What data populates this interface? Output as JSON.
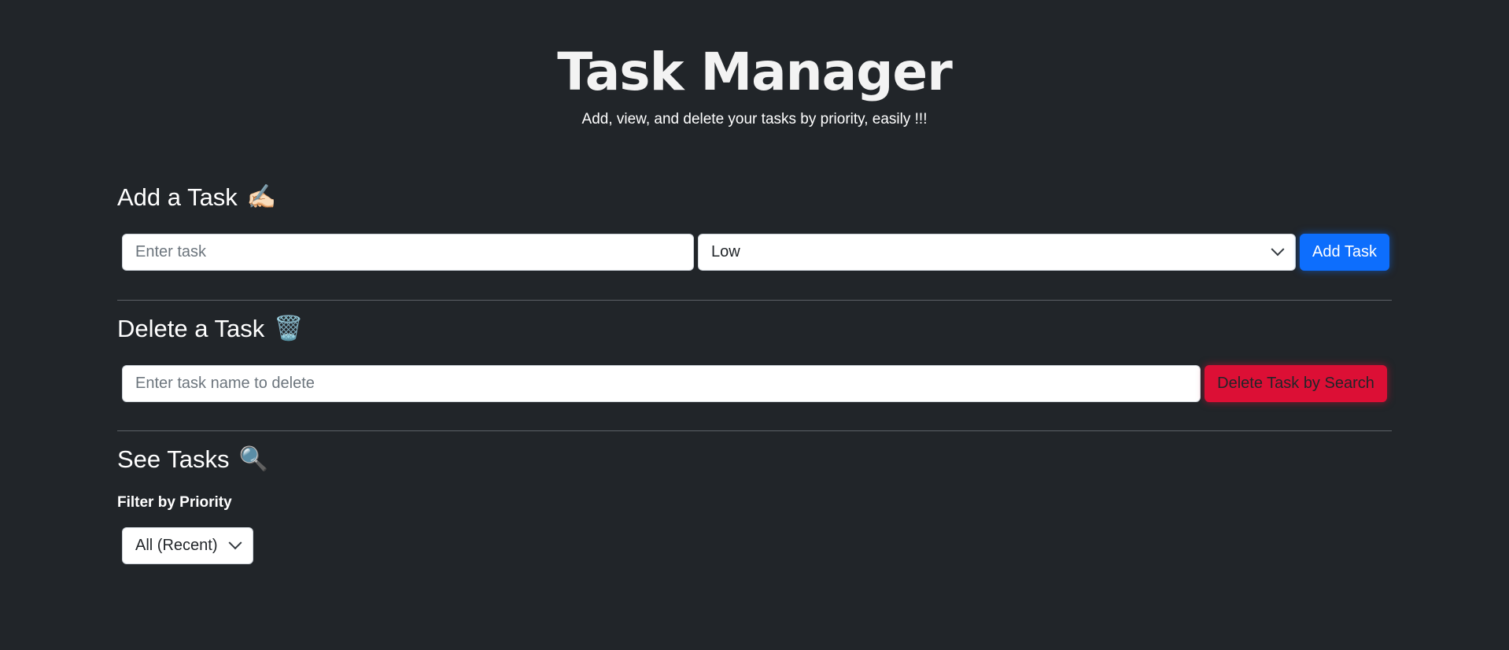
{
  "header": {
    "title": "Task Manager",
    "subtitle": "Add, view, and delete your tasks by priority, easily !!!"
  },
  "add_section": {
    "heading": "Add a Task",
    "heading_icon": "✍🏻",
    "task_input_placeholder": "Enter task",
    "task_input_value": "",
    "priority_selected": "Low",
    "add_button_label": "Add Task"
  },
  "delete_section": {
    "heading": "Delete a Task",
    "heading_icon": "🗑️",
    "delete_input_placeholder": "Enter task name to delete",
    "delete_input_value": "",
    "delete_button_label": "Delete Task by Search"
  },
  "view_section": {
    "heading": "See Tasks",
    "heading_icon": "🔍",
    "filter_label": "Filter by Priority",
    "filter_selected": "All (Recent)"
  },
  "colors": {
    "background": "#212529",
    "primary": "#0d6efd",
    "danger": "#dc0f35"
  }
}
